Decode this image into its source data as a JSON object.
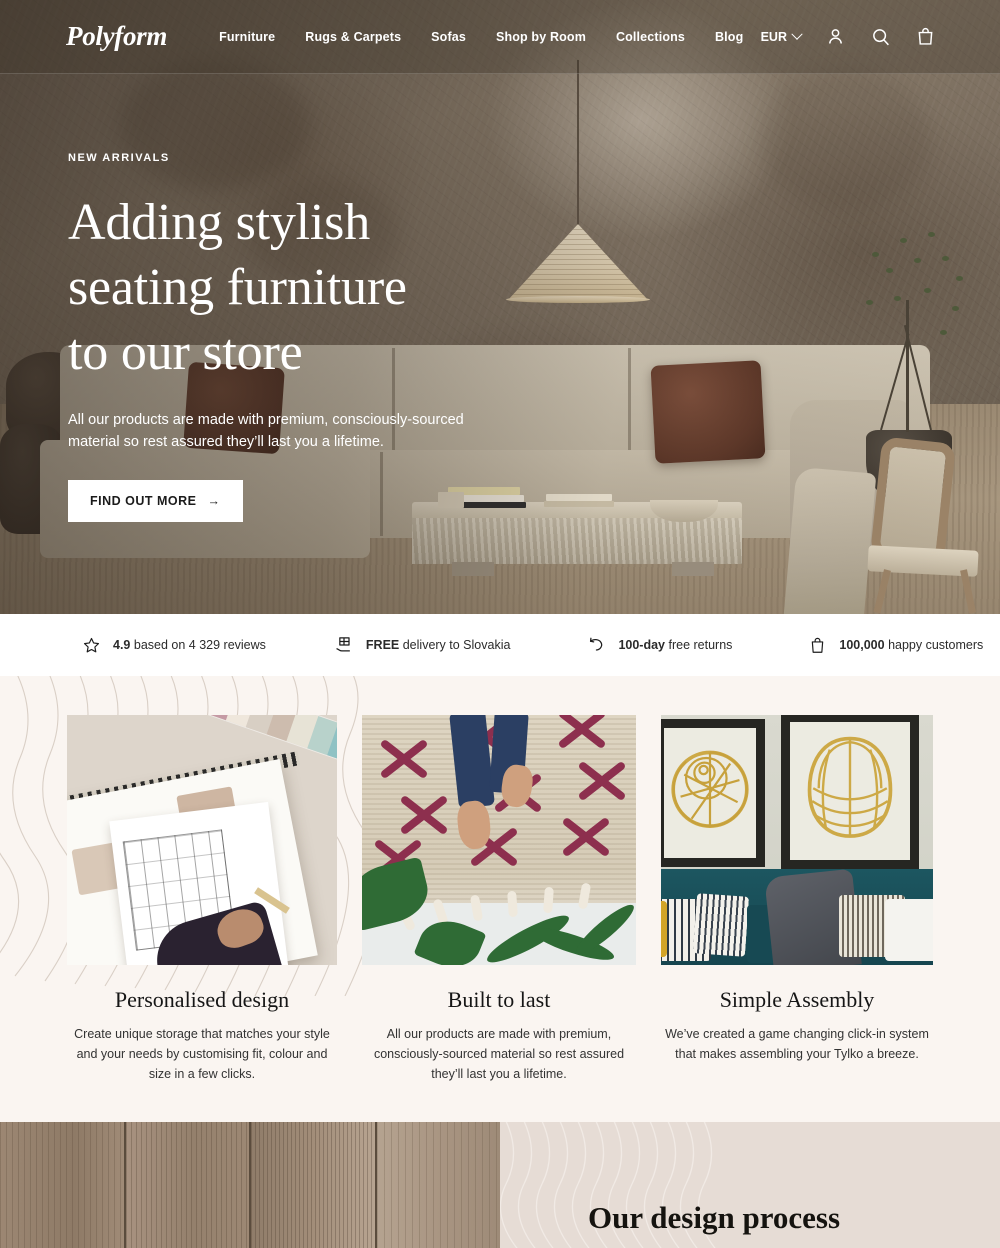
{
  "header": {
    "logo": "Polyform",
    "nav": [
      {
        "label": "Furniture"
      },
      {
        "label": "Rugs & Carpets"
      },
      {
        "label": "Sofas"
      },
      {
        "label": "Shop by Room"
      },
      {
        "label": "Collections"
      },
      {
        "label": "Blog"
      }
    ],
    "currency": "EUR",
    "icons": {
      "account": "user-icon",
      "search": "search-icon",
      "cart": "shopping-bag-icon",
      "chevron": "chevron-down-icon"
    }
  },
  "hero": {
    "eyebrow": "NEW ARRIVALS",
    "title_line1": "Adding stylish",
    "title_line2": "seating furniture",
    "title_line3": "to our store",
    "subtitle": "All our products are made with premium, consciously-sourced material so rest assured they’ll last you a lifetime.",
    "cta_label": "FIND OUT MORE",
    "cta_arrow": "→"
  },
  "trust_bar": [
    {
      "icon": "star-icon",
      "bold": "4.9",
      "rest": "based on 4 329 reviews"
    },
    {
      "icon": "delivery-box-icon",
      "bold": "FREE",
      "rest": "delivery to Slovakia"
    },
    {
      "icon": "return-arrow-icon",
      "bold": "100-day",
      "rest": "free returns"
    },
    {
      "icon": "shopping-bag-icon",
      "bold": "100,000",
      "rest": "happy customers"
    }
  ],
  "features": [
    {
      "image": "sketchbook-design-photo",
      "title": "Personalised design",
      "description": "Create unique storage that matches your style and your needs by customising fit, colour and size in a few clicks."
    },
    {
      "image": "rug-with-feet-photo",
      "title": "Built to last",
      "description": "All our products are made with premium, consciously-sourced material so rest assured they’ll last you a lifetime."
    },
    {
      "image": "framed-shell-prints-photo",
      "title": "Simple Assembly",
      "description": "We’ve created a game changing click-in system that makes assembling your Tylko a breeze."
    }
  ],
  "design_process": {
    "title": "Our design process",
    "image": "wood-planks-photo"
  },
  "colors": {
    "hero_overlay": "#3c3126",
    "features_bg": "#faf5f1",
    "bottom_bg": "#e6dcd5",
    "text_dark": "#161616",
    "white": "#ffffff",
    "rug_accent": "#8d2f4e",
    "sofa_teal": "#1c5660"
  }
}
